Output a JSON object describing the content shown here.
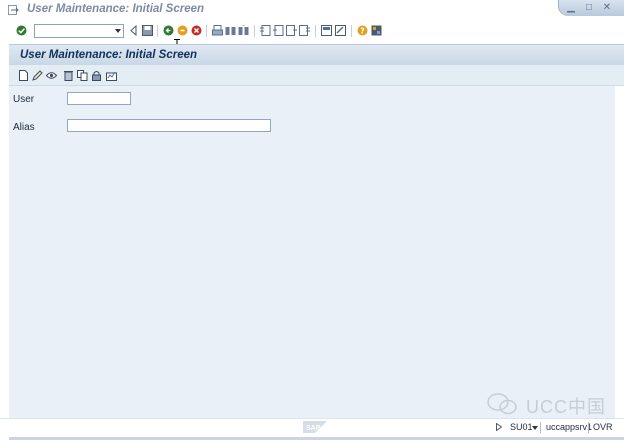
{
  "window": {
    "title": "User Maintenance: Initial Screen",
    "controls": [
      "minimize-icon",
      "maximize-icon",
      "close-icon"
    ]
  },
  "toolbar": {
    "command_field_value": "",
    "icons": [
      "enter-icon",
      "back-icon",
      "save-icon",
      "back-nav-icon",
      "exit-icon",
      "cancel-icon",
      "print-icon",
      "find-icon",
      "find-next-icon",
      "first-page-icon",
      "previous-page-icon",
      "next-page-icon",
      "last-page-icon",
      "create-session-icon",
      "shortcut-icon",
      "help-icon",
      "layout-icon"
    ]
  },
  "screen": {
    "title": "User Maintenance: Initial Screen",
    "app_toolbar_icons": [
      "create-icon",
      "change-icon",
      "display-icon",
      "delete-icon",
      "copy-icon",
      "lock-icon",
      "documentation-icon"
    ]
  },
  "form": {
    "user_label": "User",
    "user_value": "",
    "alias_label": "Alias",
    "alias_value": ""
  },
  "status": {
    "transaction": "SU01",
    "server": "uccappsrv1",
    "mode": "OVR",
    "watermark": "UCC中国",
    "brand": "SAP"
  },
  "colors": {
    "title_text": "#10315a",
    "main_bg": "#eaf0f7",
    "header_bg": "#c9d7e6"
  }
}
